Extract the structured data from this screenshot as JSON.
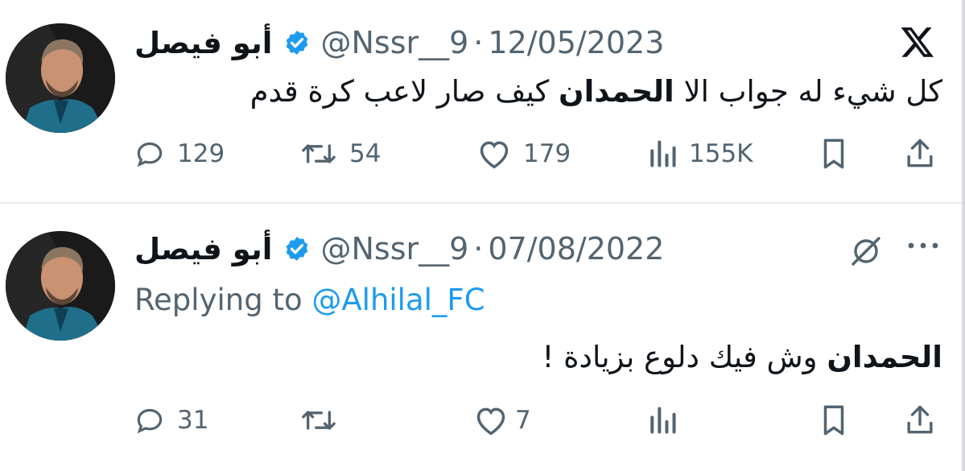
{
  "tweets": [
    {
      "author_name": "أبو فيصل",
      "handle": "@Nssr__9",
      "separator": "·",
      "date": "12/05/2023",
      "text_parts": [
        "كل شيء له جواب الا ",
        "الحمدان",
        " كيف صار لاعب كرة قدم"
      ],
      "actions": {
        "replies": "129",
        "retweets": "54",
        "likes": "179",
        "views": "155K"
      },
      "top_right_icon": "x-logo"
    },
    {
      "author_name": "أبو فيصل",
      "handle": "@Nssr__9",
      "separator": "·",
      "date": "07/08/2022",
      "replying_prefix": "Replying to ",
      "replying_to": "@Alhilal_FC",
      "text_parts": [
        "الحمدان",
        " وش فيك دلوع بزيادة !"
      ],
      "actions": {
        "replies": "31",
        "retweets": "",
        "likes": "7",
        "views": ""
      },
      "top_right_icons": [
        "grok-icon",
        "more-icon"
      ]
    }
  ],
  "colors": {
    "accent": "#1d9bf0",
    "text": "#0f1419",
    "muted": "#536471",
    "divider": "#e7e9ea"
  }
}
